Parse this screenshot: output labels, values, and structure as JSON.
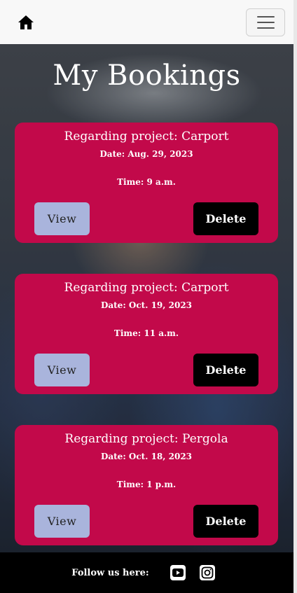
{
  "navbar": {
    "home_icon": "house-icon",
    "menu_icon": "hamburger-menu-icon"
  },
  "page": {
    "title": "My Bookings"
  },
  "bookings": [
    {
      "title": "Regarding project: Carport",
      "date": "Date: Aug. 29, 2023",
      "time": "Time: 9 a.m.",
      "view_label": "View",
      "delete_label": "Delete"
    },
    {
      "title": "Regarding project: Carport",
      "date": "Date: Oct. 19, 2023",
      "time": "Time: 11 a.m.",
      "view_label": "View",
      "delete_label": "Delete"
    },
    {
      "title": "Regarding project: Pergola",
      "date": "Date: Oct. 18, 2023",
      "time": "Time: 1 p.m.",
      "view_label": "View",
      "delete_label": "Delete"
    }
  ],
  "footer": {
    "follow_text": "Follow us here:",
    "icons": [
      "youtube-icon",
      "instagram-icon"
    ]
  },
  "colors": {
    "card_bg": "#c2094a",
    "view_button": "#a9b4dc",
    "delete_button": "#000000",
    "navbar_bg": "#f8f8f8",
    "footer_bg": "#000000"
  }
}
